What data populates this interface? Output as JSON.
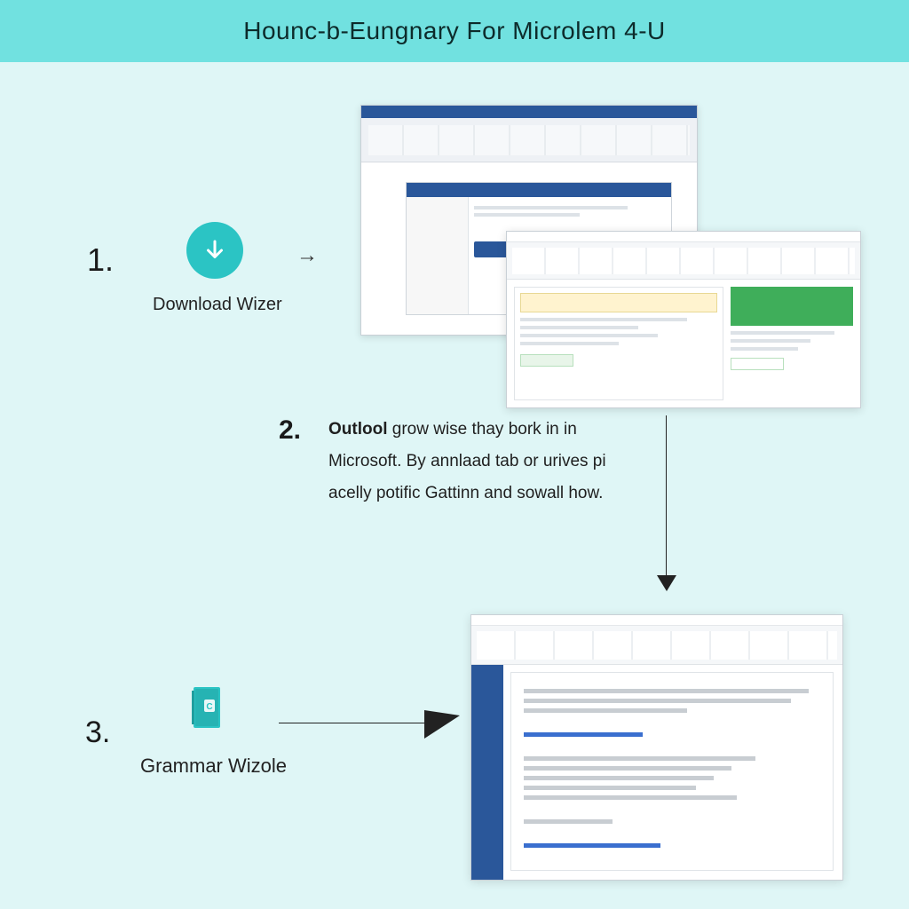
{
  "header": {
    "title": "Hounc-b-Eungnary For Microlem 4-U"
  },
  "steps": {
    "one": {
      "number": "1.",
      "label": "Download Wizer"
    },
    "two": {
      "number": "2.",
      "bold": "Outlool",
      "text_after_bold": " grow wise thay bork in in Microsoft. By annlaad tab or urives pi acelly potific Gattinn and sowall how."
    },
    "three": {
      "number": "3.",
      "label": "Grammar Wizole"
    }
  },
  "icons": {
    "download": "download-icon",
    "grammar": "grammar-book-icon",
    "arrow_right": "→"
  }
}
